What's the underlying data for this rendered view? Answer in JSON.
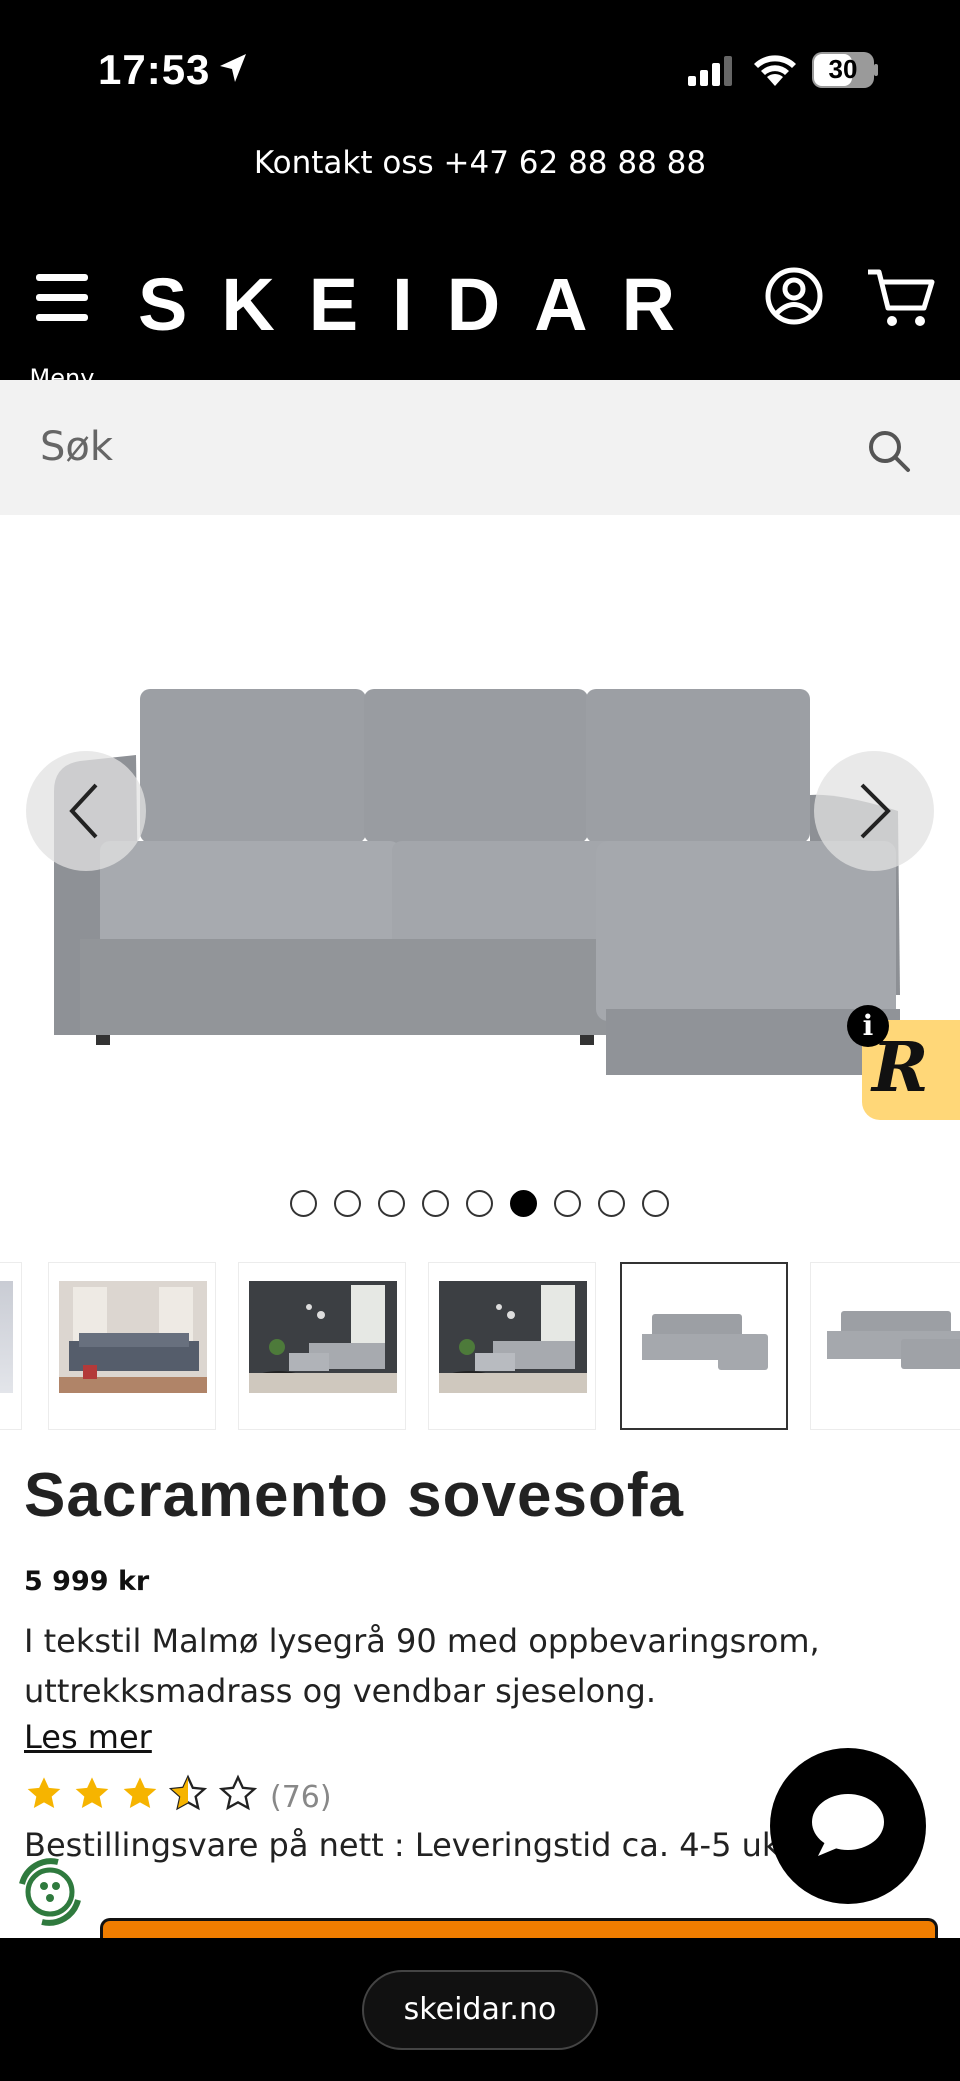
{
  "status_bar": {
    "time": "17:53",
    "battery": "30"
  },
  "contact": {
    "text": "Kontakt oss +47 62 88 88 88"
  },
  "header": {
    "logo": "SKEIDAR",
    "menu_label": "Meny"
  },
  "search": {
    "placeholder": "Søk"
  },
  "gallery": {
    "image_count": 9,
    "active_index": 6
  },
  "product": {
    "title": "Sacramento sovesofa",
    "price": "5 999 kr",
    "description": "I tekstil Malmø lysegrå 90 med oppbevaringsrom, uttrekksmadrass og vendbar sjeselong.",
    "read_more": "Les mer",
    "rating": 3.5,
    "review_count": "(76)",
    "delivery": "Bestillingsvare på nett : Leveringstid ca. 4-5 uker"
  },
  "browser": {
    "url": "skeidar.no"
  },
  "colors": {
    "accent": "#f07d00",
    "badge": "#ffd778",
    "header_bg": "#000000",
    "star": "#f6b400"
  }
}
